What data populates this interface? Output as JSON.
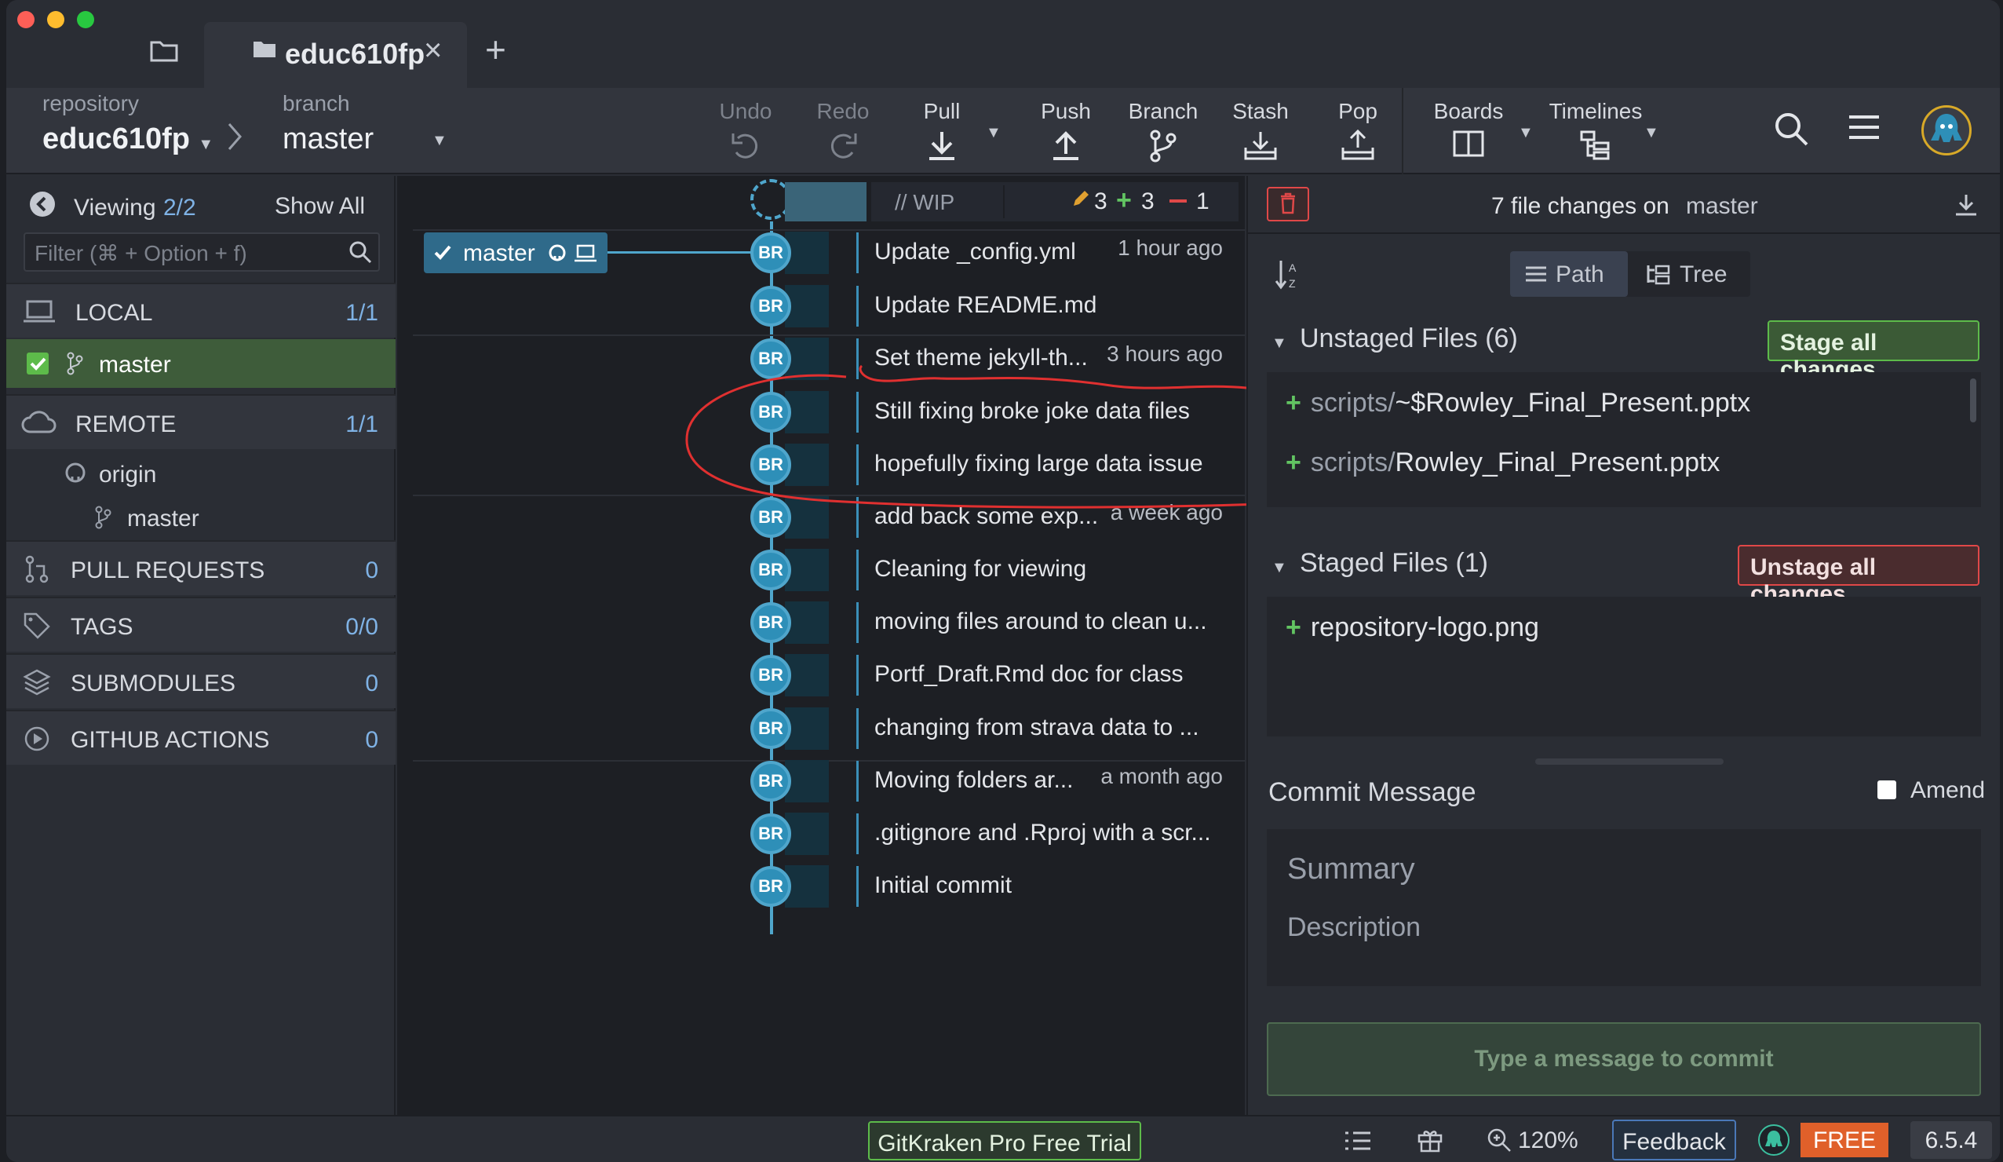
{
  "tabs": {
    "active_title": "educ610fp",
    "close": "×",
    "add": "+"
  },
  "toolbar": {
    "repo_label": "repository",
    "repo_name": "educ610fp",
    "branch_label": "branch",
    "branch_name": "master",
    "undo": "Undo",
    "redo": "Redo",
    "pull": "Pull",
    "push": "Push",
    "branch": "Branch",
    "stash": "Stash",
    "pop": "Pop",
    "boards": "Boards",
    "timelines": "Timelines"
  },
  "left": {
    "viewing_label": "Viewing",
    "viewing_count": "2/2",
    "show_all": "Show All",
    "filter_placeholder": "Filter (⌘ + Option + f)",
    "local_label": "LOCAL",
    "local_count": "1/1",
    "local_branch": "master",
    "remote_label": "REMOTE",
    "remote_count": "1/1",
    "remote_origin": "origin",
    "remote_branch": "master",
    "pull_requests_label": "PULL REQUESTS",
    "pull_requests_count": "0",
    "tags_label": "TAGS",
    "tags_count": "0/0",
    "submodules_label": "SUBMODULES",
    "submodules_count": "0",
    "actions_label": "GITHUB ACTIONS",
    "actions_count": "0"
  },
  "graph": {
    "wip_label": "// WIP",
    "wip_modified": "3",
    "wip_added": "3",
    "wip_removed": "1",
    "branch_tag": "master",
    "commits": [
      {
        "author": "BR",
        "message": "Update _config.yml",
        "time": "1 hour ago"
      },
      {
        "author": "BR",
        "message": "Update README.md",
        "time": ""
      },
      {
        "author": "BR",
        "message": "Set theme jekyll-th...",
        "time": "3 hours ago"
      },
      {
        "author": "BR",
        "message": "Still fixing broke joke data files",
        "time": ""
      },
      {
        "author": "BR",
        "message": "hopefully fixing large data issue",
        "time": ""
      },
      {
        "author": "BR",
        "message": "add back some exp...",
        "time": "a week ago"
      },
      {
        "author": "BR",
        "message": "Cleaning for viewing",
        "time": ""
      },
      {
        "author": "BR",
        "message": "moving files around to clean u...",
        "time": ""
      },
      {
        "author": "BR",
        "message": "Portf_Draft.Rmd doc for class",
        "time": ""
      },
      {
        "author": "BR",
        "message": "changing from strava data to ...",
        "time": ""
      },
      {
        "author": "BR",
        "message": "Moving folders ar...",
        "time": "a month ago"
      },
      {
        "author": "BR",
        "message": ".gitignore and .Rproj with a scr...",
        "time": ""
      },
      {
        "author": "BR",
        "message": "Initial commit",
        "time": ""
      }
    ]
  },
  "right": {
    "file_changes_text": "7 file changes on",
    "file_changes_branch": "master",
    "view_path": "Path",
    "view_tree": "Tree",
    "unstaged_label": "Unstaged Files (6)",
    "stage_all": "Stage all changes",
    "unstaged_files": [
      {
        "dir": "scripts/",
        "name": "~$Rowley_Final_Present.pptx"
      },
      {
        "dir": "scripts/",
        "name": "Rowley_Final_Present.pptx"
      }
    ],
    "staged_label": "Staged Files (1)",
    "unstage_all": "Unstage all changes",
    "staged_files": [
      {
        "name": "repository-logo.png"
      }
    ],
    "commit_message_label": "Commit Message",
    "amend_label": "Amend",
    "summary_placeholder": "Summary",
    "description_placeholder": "Description",
    "commit_button": "Type a message to commit"
  },
  "status": {
    "trial": "GitKraken Pro Free Trial",
    "zoom": "120%",
    "feedback": "Feedback",
    "plan": "FREE",
    "version": "6.5.4"
  },
  "colors": {
    "accent": "#2e8fb8",
    "added": "#62c462",
    "removed": "#e04848",
    "annotation": "#e03030"
  }
}
